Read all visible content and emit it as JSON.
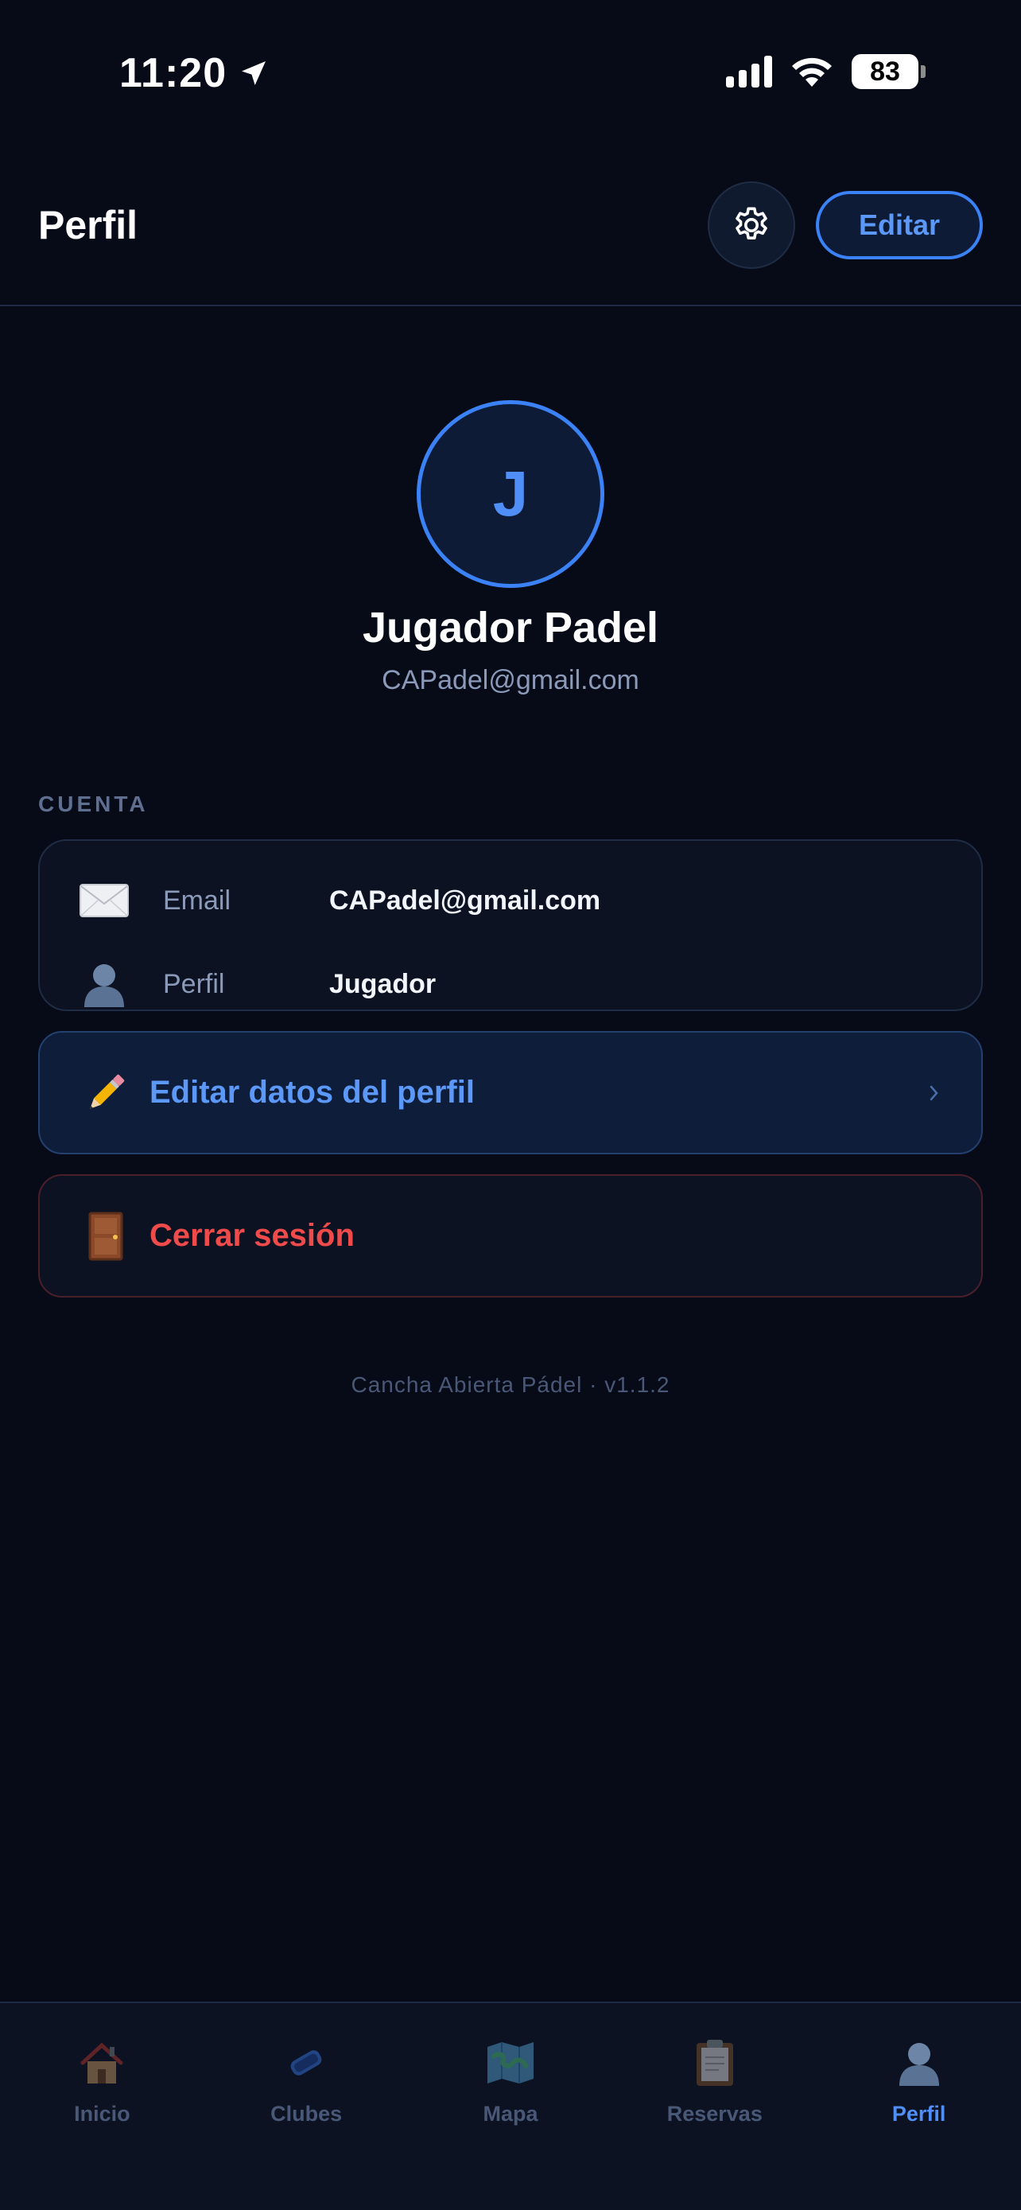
{
  "status_bar": {
    "time": "11:20",
    "battery": "83"
  },
  "header": {
    "title": "Perfil",
    "edit_label": "Editar"
  },
  "profile": {
    "initial": "J",
    "name": "Jugador Padel",
    "email": "CAPadel@gmail.com"
  },
  "account": {
    "section_label": "CUENTA",
    "rows": [
      {
        "label": "Email",
        "value": "CAPadel@gmail.com",
        "icon": "envelope-icon"
      },
      {
        "label": "Perfil",
        "value": "Jugador",
        "icon": "user-silhouette-icon"
      }
    ]
  },
  "actions": {
    "edit_profile": {
      "label": "Editar datos del perfil",
      "icon": "pencil-icon"
    },
    "logout": {
      "label": "Cerrar sesión",
      "icon": "door-icon"
    }
  },
  "footer": {
    "version": "Cancha Abierta Pádel · v1.1.2"
  },
  "tabs": [
    {
      "label": "Inicio",
      "icon": "house-icon",
      "active": false
    },
    {
      "label": "Clubes",
      "icon": "paddle-icon",
      "active": false
    },
    {
      "label": "Mapa",
      "icon": "map-icon",
      "active": false
    },
    {
      "label": "Reservas",
      "icon": "clipboard-icon",
      "active": false
    },
    {
      "label": "Perfil",
      "icon": "user-silhouette-icon",
      "active": true
    }
  ],
  "colors": {
    "accent": "#3b82f6",
    "danger": "#ef4b4b",
    "background": "#070b18"
  }
}
